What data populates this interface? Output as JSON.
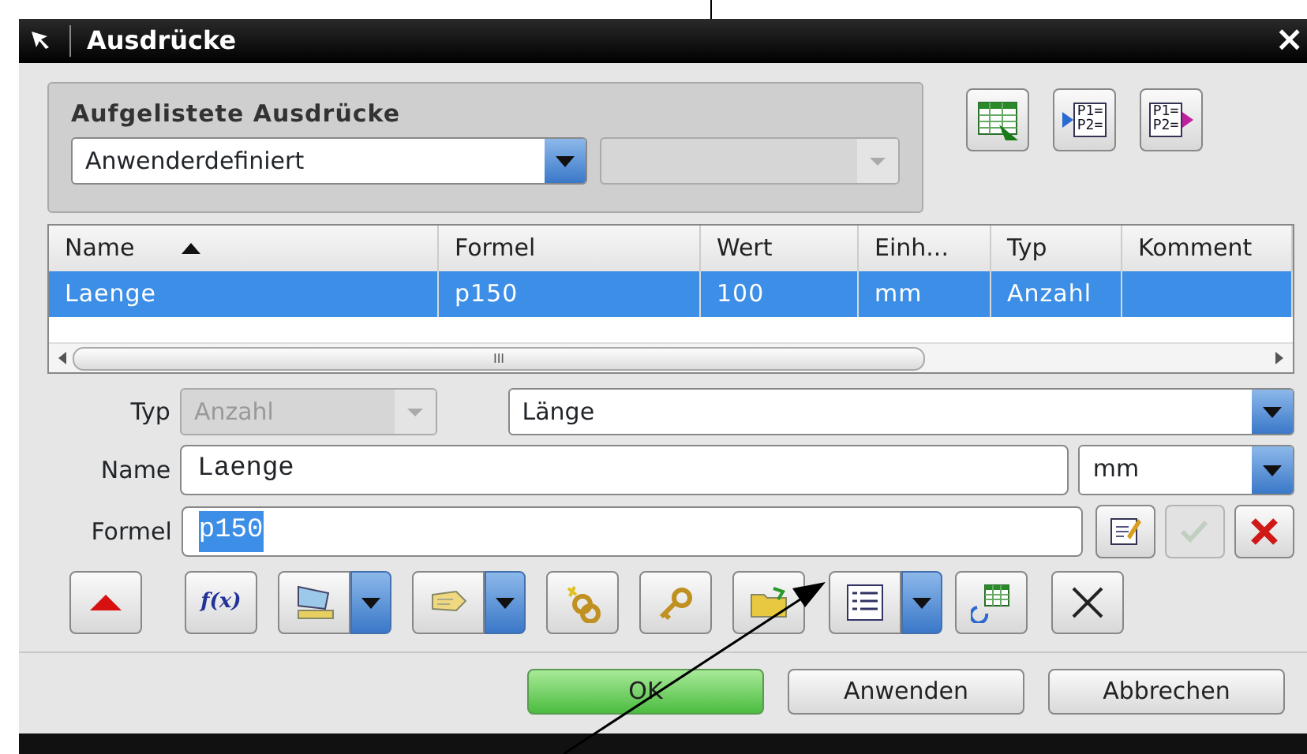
{
  "window": {
    "title": "Ausdrücke",
    "close": "×"
  },
  "listed": {
    "label": "Aufgelistete Ausdrücke",
    "filter": {
      "value": "Anwenderdefiniert",
      "disabled": false
    },
    "secondary": {
      "disabled": true
    }
  },
  "top_icons": [
    {
      "kind": "spreadsheet"
    },
    {
      "kind": "params-import",
      "lines": [
        "P1=",
        "P2="
      ]
    },
    {
      "kind": "params-export",
      "lines": [
        "P1=",
        "P2="
      ]
    }
  ],
  "table": {
    "columns": [
      {
        "label": "Name",
        "sort_ascending": true
      },
      {
        "label": "Formel"
      },
      {
        "label": "Wert"
      },
      {
        "label": "Einh..."
      },
      {
        "label": "Typ"
      },
      {
        "label": "Komment"
      }
    ],
    "rows": [
      {
        "selected": true,
        "cells": [
          "Laenge",
          "p150",
          "100",
          "mm",
          "Anzahl",
          ""
        ]
      }
    ],
    "scroll_grip": "III"
  },
  "form": {
    "type_label": "Typ",
    "type": {
      "value": "Anzahl",
      "disabled": true
    },
    "dimension": {
      "value": "Länge",
      "disabled": false
    },
    "name_label": "Name",
    "name": "Laenge",
    "unit": {
      "value": "mm",
      "disabled": false
    },
    "formula_label": "Formel",
    "formula": {
      "value": "p150",
      "text_selected": true
    },
    "formula_buttons": [
      {
        "kind": "edit",
        "disabled": false
      },
      {
        "kind": "accept",
        "disabled": true
      },
      {
        "kind": "reject",
        "disabled": false
      }
    ]
  },
  "toolbar": [
    {
      "kind": "collapse",
      "split": false
    },
    {
      "kind": "function",
      "split": false,
      "label": "f(x)"
    },
    {
      "kind": "measure",
      "split": true
    },
    {
      "kind": "tag",
      "split": true
    },
    {
      "kind": "link",
      "split": false
    },
    {
      "kind": "keys",
      "split": false
    },
    {
      "kind": "folder",
      "split": false
    },
    {
      "kind": "list",
      "split": true
    },
    {
      "kind": "refresh-sheet",
      "split": false
    },
    {
      "kind": "delete",
      "split": false
    }
  ],
  "buttons": [
    {
      "label": "OK",
      "default": true
    },
    {
      "label": "Anwenden",
      "default": false
    },
    {
      "label": "Abbrechen",
      "default": false
    }
  ]
}
